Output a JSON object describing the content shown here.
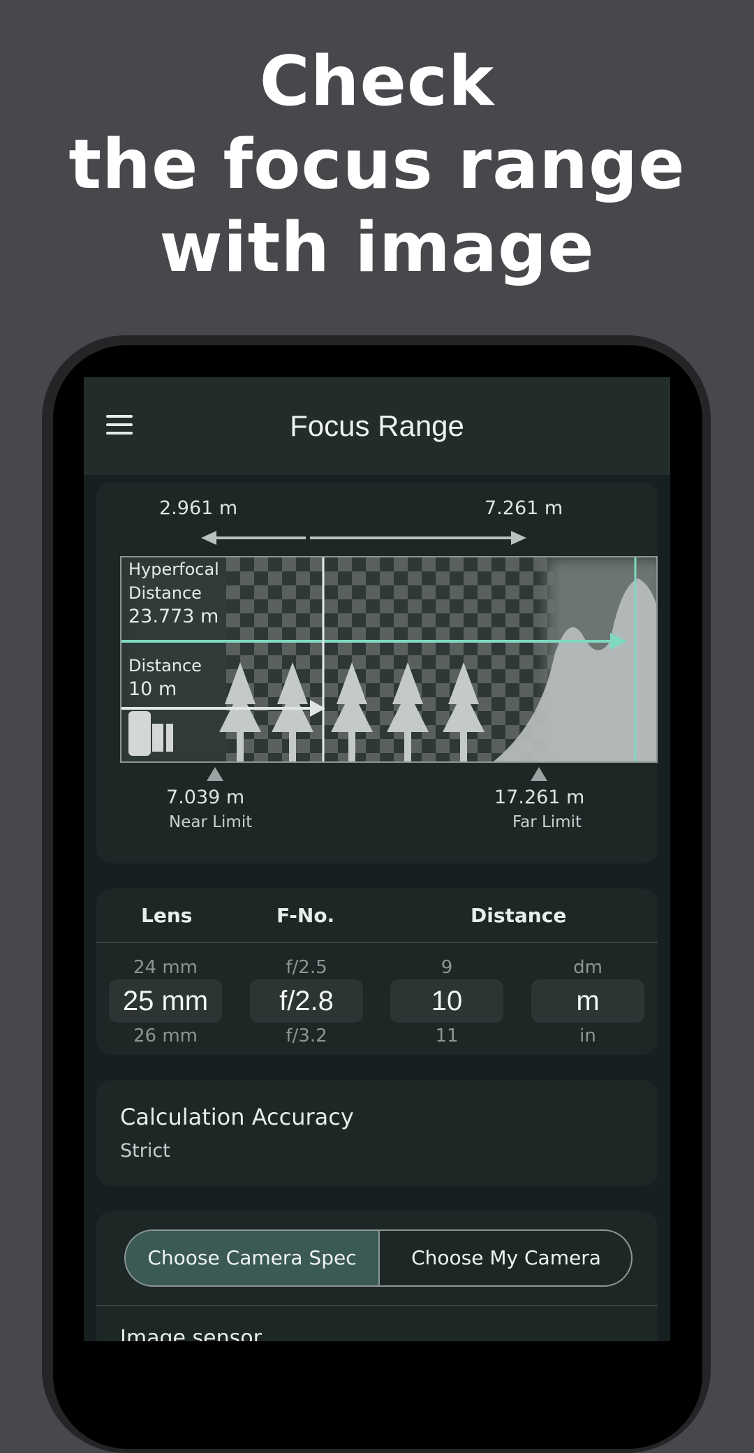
{
  "headline": {
    "line1": "Check",
    "line2": "the focus range",
    "line3": "with image"
  },
  "appbar": {
    "title": "Focus Range",
    "menu_icon": "hamburger-menu-icon"
  },
  "focus_card": {
    "near_marker": "2.961 m",
    "far_marker": "7.261 m",
    "hyperfocal_label_1": "Hyperfocal",
    "hyperfocal_label_2": "Distance",
    "hyperfocal_value": "23.773 m",
    "distance_label": "Distance",
    "distance_value": "10 m",
    "near_limit_value": "7.039 m",
    "near_limit_label": "Near Limit",
    "far_limit_value": "17.261 m",
    "far_limit_label": "Far Limit",
    "colors": {
      "accent": "#7fd9c0",
      "arrow": "#b9c2c0"
    }
  },
  "picker": {
    "headers": {
      "lens": "Lens",
      "fno": "F-No.",
      "distance": "Distance"
    },
    "columns": [
      {
        "prev": "24 mm",
        "current": "25 mm",
        "next": "26 mm"
      },
      {
        "prev": "f/2.5",
        "current": "f/2.8",
        "next": "f/3.2"
      },
      {
        "prev": "9",
        "current": "10",
        "next": "11"
      },
      {
        "prev": "dm",
        "current": "m",
        "next": "in"
      }
    ]
  },
  "accuracy": {
    "title": "Calculation Accuracy",
    "value": "Strict"
  },
  "camera": {
    "spec_button": "Choose Camera Spec",
    "my_camera_button": "Choose My Camera",
    "next_section": "Image sensor"
  }
}
